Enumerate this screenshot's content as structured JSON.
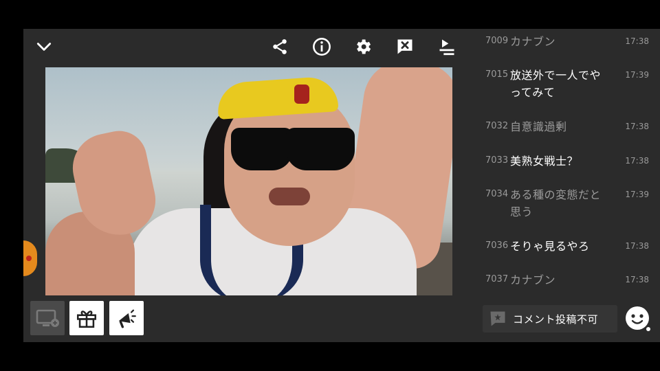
{
  "colors": {
    "background": "#2b2b2b",
    "accent_orange": "#e58a1d",
    "dim_text": "#9b9b9b",
    "bright_text": "#ffffff"
  },
  "topbar": {
    "icons": [
      "chevron-down-icon",
      "share-icon",
      "info-icon",
      "gear-icon",
      "comment-off-icon",
      "playlist-icon"
    ]
  },
  "bottombar": {
    "icons": [
      "screen-switch-icon",
      "gift-icon",
      "megaphone-icon"
    ]
  },
  "comments": [
    {
      "num": "7009",
      "text": "カナブン",
      "time": "17:38",
      "style": "dim"
    },
    {
      "num": "7015",
      "text": "放送外で一人でやってみて",
      "time": "17:39",
      "style": "bright"
    },
    {
      "num": "7032",
      "text": "自意識過剰",
      "time": "17:38",
      "style": "dim"
    },
    {
      "num": "7033",
      "text": "美熟女戦士？",
      "time": "17:38",
      "style": "bright"
    },
    {
      "num": "7034",
      "text": "ある種の変態だと思う",
      "time": "17:39",
      "style": "dim"
    },
    {
      "num": "7036",
      "text": "そりゃ見るやろ",
      "time": "17:38",
      "style": "bright"
    },
    {
      "num": "7037",
      "text": "カナブン",
      "time": "17:38",
      "style": "dim"
    }
  ],
  "comment_box": {
    "label": "コメント投稿不可",
    "icon": "comment-icon"
  },
  "emoji_button": {
    "icon": "smiley-face-icon"
  }
}
